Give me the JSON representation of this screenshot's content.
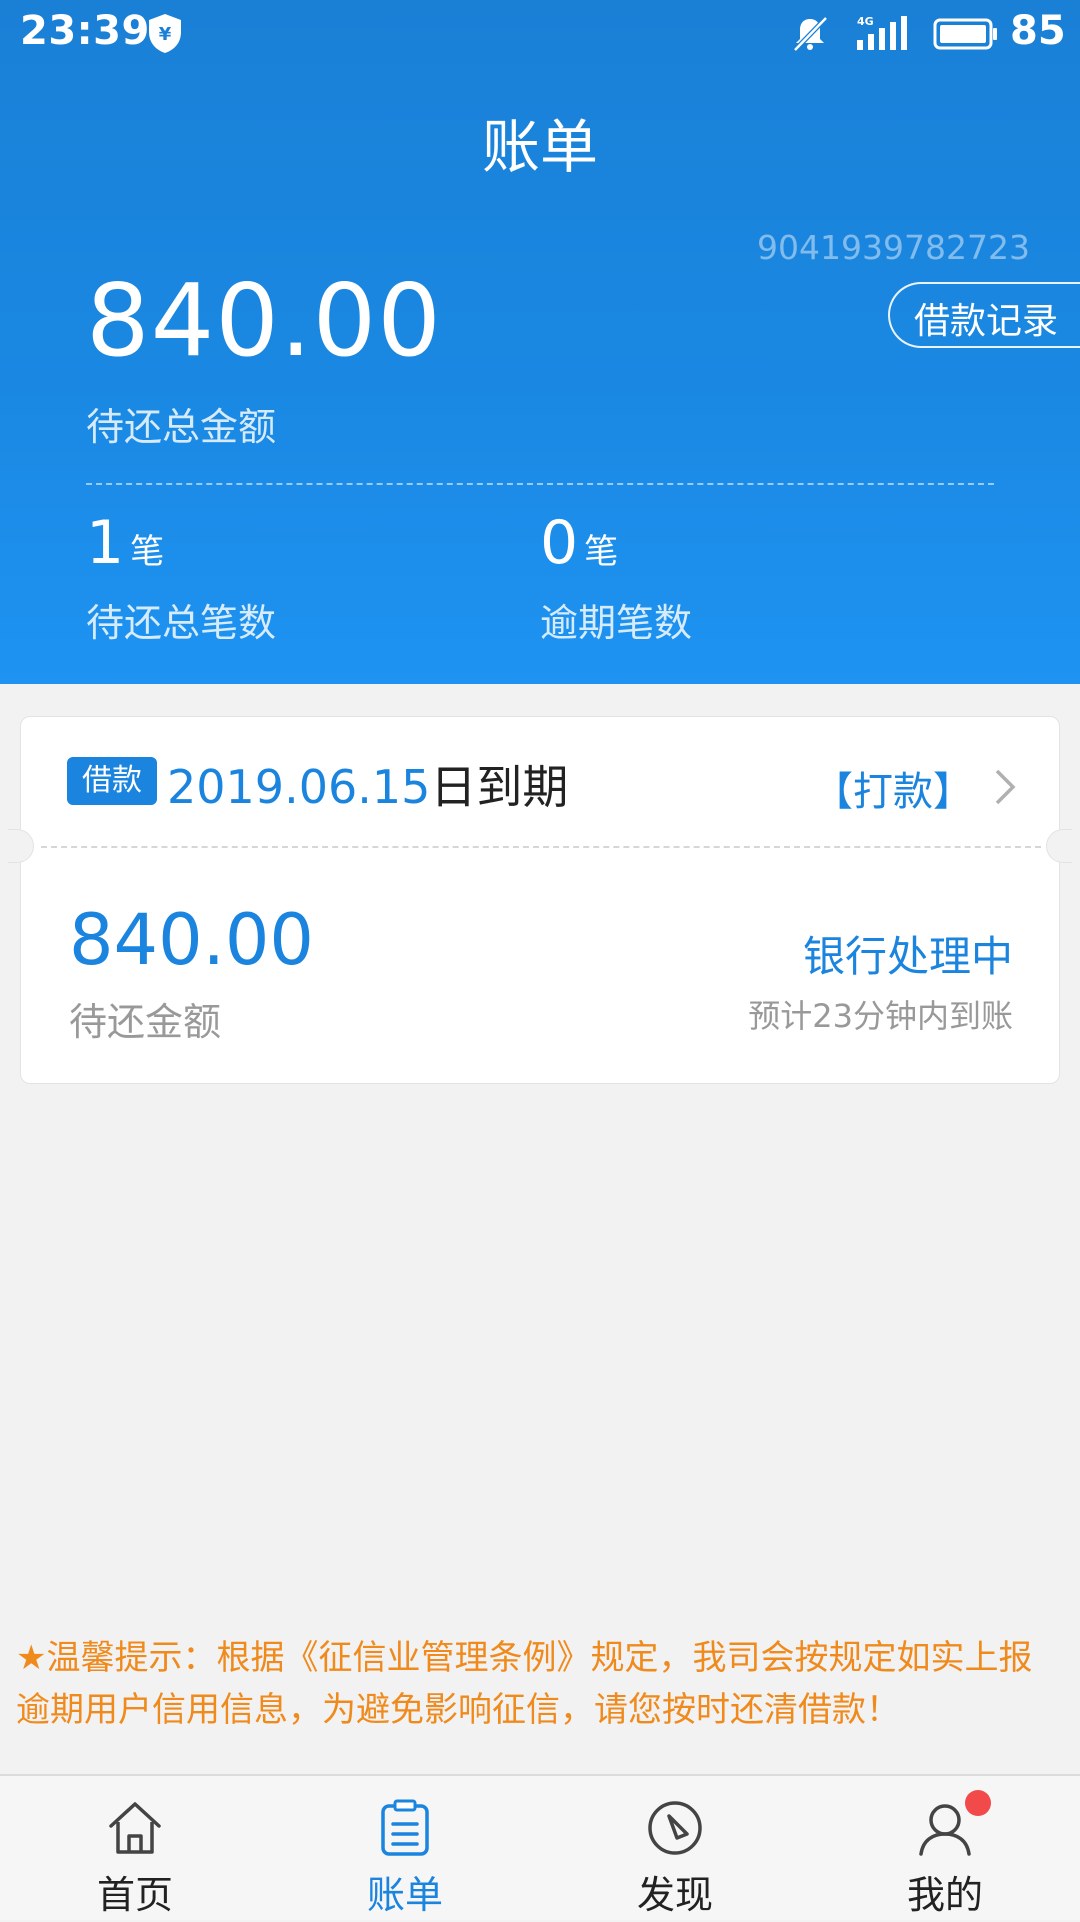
{
  "status_bar": {
    "time": "23:39",
    "battery": "85",
    "network": "4G"
  },
  "header": {
    "title": "账单",
    "account_no": "9041939782723",
    "loan_record_label": "借款记录",
    "total_amount": "840.00",
    "total_amount_label": "待还总金额",
    "stats": {
      "total_count": "1",
      "total_unit": "笔",
      "total_label": "待还总笔数",
      "overdue_count": "0",
      "overdue_unit": "笔",
      "overdue_label": "逾期笔数"
    }
  },
  "bill": {
    "tag": "借款",
    "date": "2019.06.15",
    "date_suffix": "日到期",
    "pay_label": "【打款】",
    "amount": "840.00",
    "amount_label": "待还金额",
    "status": "银行处理中",
    "eta": "预计23分钟内到账"
  },
  "notice": "★温馨提示：根据《征信业管理条例》规定，我司会按规定如实上报逾期用户信用信息，为避免影响征信，请您按时还清借款！",
  "nav": {
    "home": "首页",
    "bill": "账单",
    "discover": "发现",
    "mine": "我的"
  },
  "colors": {
    "primary": "#1a84de",
    "header_top": "#1a80d6",
    "header_bottom": "#1e93f2",
    "notice": "#f08a1c",
    "badge": "#f24a4a"
  }
}
